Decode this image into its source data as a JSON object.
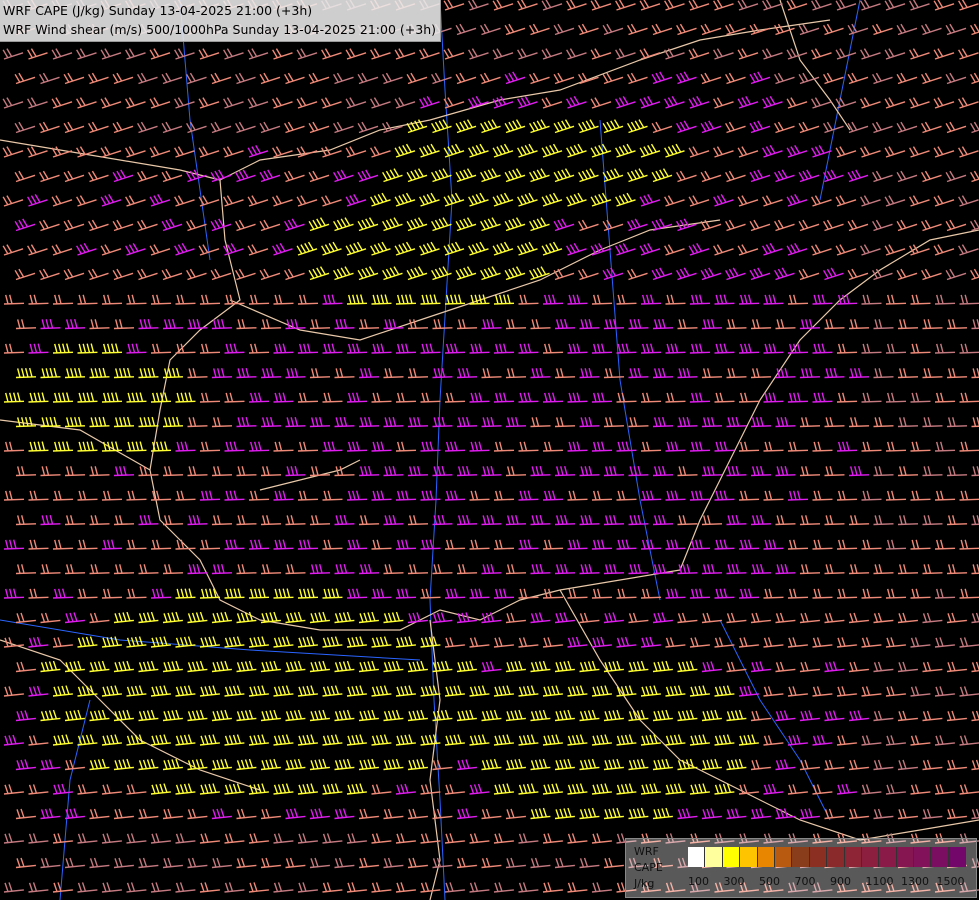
{
  "header": {
    "line1": "WRF CAPE (J/kg) Sunday 13-04-2025 21:00 (+3h)",
    "line2": "WRF Wind shear (m/s) 500/1000hPa Sunday 13-04-2025 21:00 (+3h)"
  },
  "legend": {
    "model": "WRF",
    "variable": "CAPE",
    "unit": "J/kg",
    "tick_labels": [
      "100",
      "300",
      "500",
      "700",
      "900",
      "1100",
      "1300",
      "1500"
    ],
    "colors": [
      "#ffffff",
      "#ffff9e",
      "#ffff00",
      "#ffc400",
      "#e88600",
      "#b85a10",
      "#8a3d1a",
      "#8a2f22",
      "#8a2a2a",
      "#8e2536",
      "#8c1f3f",
      "#8a1a48",
      "#861652",
      "#82125a",
      "#7c0e62",
      "#74086a"
    ]
  },
  "map_colors": {
    "background": "#000000",
    "barb_yellow": "#ffff33",
    "barb_magenta": "#e01cf0",
    "barb_salmon": "#f08a78",
    "barb_rose": "#c47a80",
    "border": "#e8c8a8",
    "river": "#2a64ff"
  }
}
